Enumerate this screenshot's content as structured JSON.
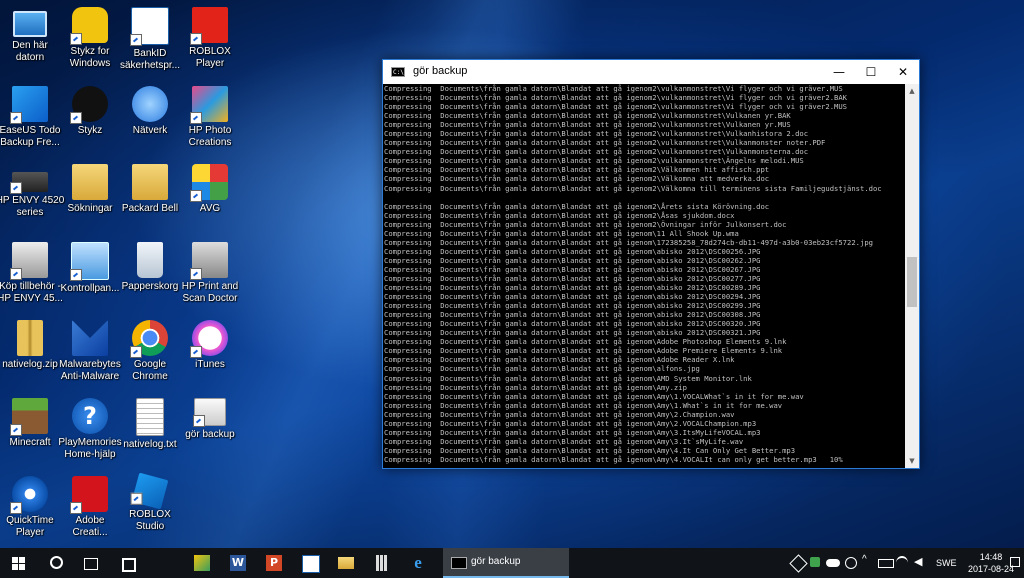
{
  "desktop": {
    "icons": [
      {
        "label": "Den här\ndatorn"
      },
      {
        "label": "Stykz for\nWindows"
      },
      {
        "label": "BankID\nsäkerhetspr..."
      },
      {
        "label": "ROBLOX\nPlayer"
      },
      {
        "label": "EaseUS Todo\nBackup Fre..."
      },
      {
        "label": "Stykz"
      },
      {
        "label": "Nätverk"
      },
      {
        "label": "HP Photo\nCreations"
      },
      {
        "label": "HP ENVY 4520\nseries"
      },
      {
        "label": "Sökningar"
      },
      {
        "label": "Packard Bell"
      },
      {
        "label": "AVG"
      },
      {
        "label": "Köp tillbehör -\nHP ENVY 45..."
      },
      {
        "label": "Kontrollpan..."
      },
      {
        "label": "Papperskorg"
      },
      {
        "label": "HP Print and\nScan Doctor"
      },
      {
        "label": "nativelog.zip"
      },
      {
        "label": "Malwarebytes\nAnti-Malware"
      },
      {
        "label": "Google\nChrome"
      },
      {
        "label": "iTunes"
      },
      {
        "label": "Minecraft"
      },
      {
        "label": "PlayMemories\nHome-hjälp"
      },
      {
        "label": "nativelog.txt"
      },
      {
        "label": "gör backup"
      },
      {
        "label": "QuickTime\nPlayer"
      },
      {
        "label": "Adobe\nCreati..."
      },
      {
        "label": "ROBLOX\nStudio"
      }
    ]
  },
  "window": {
    "title": "gör backup",
    "icon_text": "C:\\",
    "minimize": "—",
    "maximize": "☐",
    "close": "✕",
    "lines": [
      "Compressing  Documents\\från gamla datorn\\Blandat att gå igenom2\\vulkanmonstret\\Vi flyger och vi gräver.MUS",
      "Compressing  Documents\\från gamla datorn\\Blandat att gå igenom2\\vulkanmonstret\\Vi flyger och vi gräver2.BAK",
      "Compressing  Documents\\från gamla datorn\\Blandat att gå igenom2\\vulkanmonstret\\Vi flyger och vi gräver2.MUS",
      "Compressing  Documents\\från gamla datorn\\Blandat att gå igenom2\\vulkanmonstret\\Vulkanen yr.BAK",
      "Compressing  Documents\\från gamla datorn\\Blandat att gå igenom2\\vulkanmonstret\\Vulkanen yr.MUS",
      "Compressing  Documents\\från gamla datorn\\Blandat att gå igenom2\\vulkanmonstret\\Vulkanhistora 2.doc",
      "Compressing  Documents\\från gamla datorn\\Blandat att gå igenom2\\vulkanmonstret\\Vulkanmonster noter.PDF",
      "Compressing  Documents\\från gamla datorn\\Blandat att gå igenom2\\vulkanmonstret\\Vulkanmonsterna.doc",
      "Compressing  Documents\\från gamla datorn\\Blandat att gå igenom2\\vulkanmonstret\\Ängelns melodi.MUS",
      "Compressing  Documents\\från gamla datorn\\Blandat att gå igenom2\\Välkommen hit affisch.ppt",
      "Compressing  Documents\\från gamla datorn\\Blandat att gå igenom2\\Välkomna att medverka.doc",
      "Compressing  Documents\\från gamla datorn\\Blandat att gå igenom2\\Välkomna till terminens sista Familjegudstjänst.doc",
      "",
      "Compressing  Documents\\från gamla datorn\\Blandat att gå igenom2\\Årets sista Körövning.doc",
      "Compressing  Documents\\från gamla datorn\\Blandat att gå igenom2\\Åsas sjukdom.docx",
      "Compressing  Documents\\från gamla datorn\\Blandat att gå igenom2\\Övningar inför Julkonsert.doc",
      "Compressing  Documents\\från gamla datorn\\Blandat att gå igenom\\11 All Shook Up.wma",
      "Compressing  Documents\\från gamla datorn\\Blandat att gå igenom\\172385258_78d274cb-db11-497d-a3b0-03eb23cf5722.jpg",
      "Compressing  Documents\\från gamla datorn\\Blandat att gå igenom\\abisko 2012\\DSC00256.JPG",
      "Compressing  Documents\\från gamla datorn\\Blandat att gå igenom\\abisko 2012\\DSC00262.JPG",
      "Compressing  Documents\\från gamla datorn\\Blandat att gå igenom\\abisko 2012\\DSC00267.JPG",
      "Compressing  Documents\\från gamla datorn\\Blandat att gå igenom\\abisko 2012\\DSC00277.JPG",
      "Compressing  Documents\\från gamla datorn\\Blandat att gå igenom\\abisko 2012\\DSC00289.JPG",
      "Compressing  Documents\\från gamla datorn\\Blandat att gå igenom\\abisko 2012\\DSC00294.JPG",
      "Compressing  Documents\\från gamla datorn\\Blandat att gå igenom\\abisko 2012\\DSC00299.JPG",
      "Compressing  Documents\\från gamla datorn\\Blandat att gå igenom\\abisko 2012\\DSC00308.JPG",
      "Compressing  Documents\\från gamla datorn\\Blandat att gå igenom\\abisko 2012\\DSC00320.JPG",
      "Compressing  Documents\\från gamla datorn\\Blandat att gå igenom\\abisko 2012\\DSC00321.JPG",
      "Compressing  Documents\\från gamla datorn\\Blandat att gå igenom\\Adobe Photoshop Elements 9.lnk",
      "Compressing  Documents\\från gamla datorn\\Blandat att gå igenom\\Adobe Premiere Elements 9.lnk",
      "Compressing  Documents\\från gamla datorn\\Blandat att gå igenom\\Adobe Reader X.lnk",
      "Compressing  Documents\\från gamla datorn\\Blandat att gå igenom\\alfons.jpg",
      "Compressing  Documents\\från gamla datorn\\Blandat att gå igenom\\AMD System Monitor.lnk",
      "Compressing  Documents\\från gamla datorn\\Blandat att gå igenom\\Amy.zip",
      "Compressing  Documents\\från gamla datorn\\Blandat att gå igenom\\Amy\\1.VOCALWhat`s in it for me.wav",
      "Compressing  Documents\\från gamla datorn\\Blandat att gå igenom\\Amy\\1.What`s in it for me.wav",
      "Compressing  Documents\\från gamla datorn\\Blandat att gå igenom\\Amy\\2.Champion.wav",
      "Compressing  Documents\\från gamla datorn\\Blandat att gå igenom\\Amy\\2.VOCALChampion.mp3",
      "Compressing  Documents\\från gamla datorn\\Blandat att gå igenom\\Amy\\3.ItsMyLifeVOCAL.mp3",
      "Compressing  Documents\\från gamla datorn\\Blandat att gå igenom\\Amy\\3.It`sMyLife.wav",
      "Compressing  Documents\\från gamla datorn\\Blandat att gå igenom\\Amy\\4.It Can Only Get Better.mp3",
      "Compressing  Documents\\från gamla datorn\\Blandat att gå igenom\\Amy\\4.VOCALIt can only get better.mp3   10%"
    ]
  },
  "taskbar": {
    "active_app_label": "gör backup",
    "language": "SWE",
    "time": "14:48",
    "date": "2017-08-24"
  },
  "colors": {
    "console_text": "#c0c0c0",
    "accent": "#76b9ed"
  }
}
